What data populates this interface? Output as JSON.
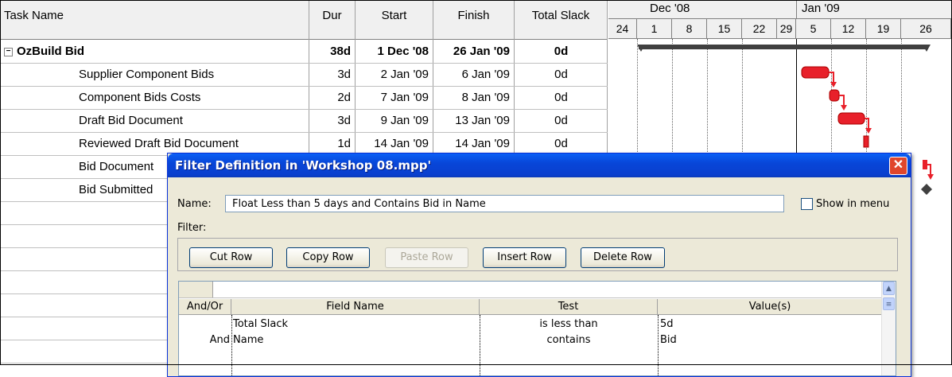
{
  "table": {
    "headers": {
      "task_name": "Task Name",
      "dur": "Dur",
      "start": "Start",
      "finish": "Finish",
      "slack": "Total Slack"
    },
    "summary": {
      "name": "OzBuild Bid",
      "dur": "38d",
      "start": "1 Dec '08",
      "finish": "26 Jan '09",
      "slack": "0d"
    },
    "rows": [
      {
        "name": "Supplier Component Bids",
        "dur": "3d",
        "start": "2 Jan '09",
        "finish": "6 Jan '09",
        "slack": "0d"
      },
      {
        "name": "Component Bids Costs",
        "dur": "2d",
        "start": "7 Jan '09",
        "finish": "8 Jan '09",
        "slack": "0d"
      },
      {
        "name": "Draft Bid Document",
        "dur": "3d",
        "start": "9 Jan '09",
        "finish": "13 Jan '09",
        "slack": "0d"
      },
      {
        "name": "Reviewed Draft Bid Document",
        "dur": "1d",
        "start": "14 Jan '09",
        "finish": "14 Jan '09",
        "slack": "0d"
      },
      {
        "name": "Bid Document",
        "dur": "",
        "start": "",
        "finish": "",
        "slack": ""
      },
      {
        "name": "Bid Submitted",
        "dur": "",
        "start": "",
        "finish": "",
        "slack": ""
      }
    ]
  },
  "gantt": {
    "months": [
      "Dec '08",
      "Jan '09"
    ],
    "weeks": [
      "24",
      "1",
      "8",
      "15",
      "22",
      "29",
      "5",
      "12",
      "19",
      "26"
    ],
    "bar_color": "#e8202a"
  },
  "dialog": {
    "title": "Filter Definition in 'Workshop 08.mpp'",
    "name_label": "Name:",
    "name_value": "Float Less than 5 days and Contains Bid in Name",
    "show_in_menu": "Show in menu",
    "filter_label": "Filter:",
    "buttons": {
      "cut_row": "Cut Row",
      "copy_row": "Copy Row",
      "paste_row": "Paste Row",
      "insert_row": "Insert Row",
      "delete_row": "Delete Row"
    },
    "grid": {
      "headers": {
        "and_or": "And/Or",
        "field": "Field Name",
        "test": "Test",
        "values": "Value(s)"
      },
      "rows": [
        {
          "and_or": "",
          "field": "Total Slack",
          "test": "is less than",
          "value": "5d"
        },
        {
          "and_or": "And",
          "field": "Name",
          "test": "contains",
          "value": "Bid"
        }
      ]
    }
  }
}
